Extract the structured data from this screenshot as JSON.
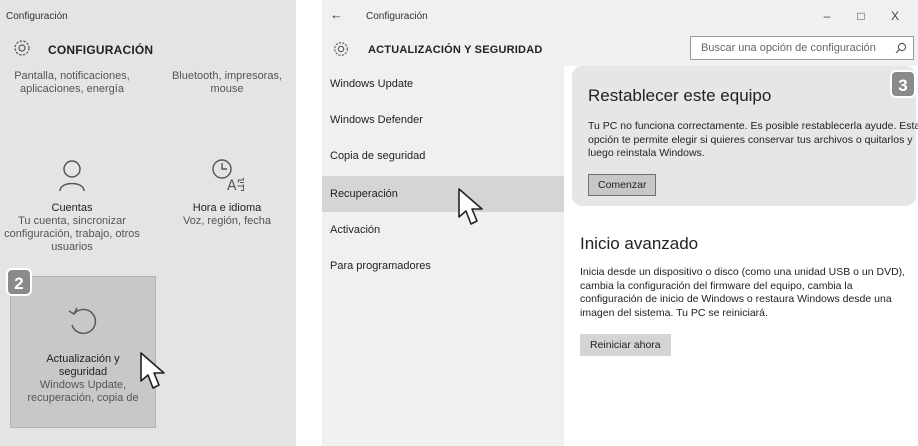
{
  "left": {
    "window_title": "Configuración",
    "header": "CONFIGURACIÓN",
    "tiles": {
      "pantalla": {
        "desc": "Pantalla, notificaciones, aplicaciones, energía"
      },
      "bluetooth": {
        "desc": "Bluetooth, impresoras, mouse"
      },
      "cuentas": {
        "title": "Cuentas",
        "desc": "Tu cuenta, sincronizar configuración, trabajo, otros usuarios",
        "icon": "person-icon"
      },
      "hora": {
        "title": "Hora e idioma",
        "desc": "Voz, región, fecha",
        "icon": "time-language-icon"
      },
      "actualizacion": {
        "title": "Actualización y seguridad",
        "desc": "Windows Update, recuperación, copia de",
        "icon": "update-icon"
      }
    },
    "badge": "2"
  },
  "right": {
    "window_title": "Configuración",
    "window_controls": {
      "minimize": "–",
      "maximize": "□",
      "close": "X"
    },
    "header": "ACTUALIZACIÓN Y SEGURIDAD",
    "search": {
      "placeholder": "Buscar una opción de configuración"
    },
    "nav": [
      {
        "label": "Windows Update"
      },
      {
        "label": "Windows Defender"
      },
      {
        "label": "Copia de seguridad"
      },
      {
        "label": "Recuperación",
        "active": true
      },
      {
        "label": "Activación"
      },
      {
        "label": "Para programadores"
      }
    ],
    "reset": {
      "title": "Restablecer este equipo",
      "desc": "Tu PC no funciona correctamente. Es posible restablecerla ayude. Esta opción te permite elegir si quieres conservar tus archivos o quitarlos y luego reinstala Windows.",
      "button": "Comenzar"
    },
    "advanced": {
      "title": "Inicio avanzado",
      "desc": "Inicia desde un dispositivo o disco (como una unidad USB o un DVD), cambia la configuración del firmware del equipo, cambia la configuración de inicio de Windows o restaura Windows desde una imagen del sistema. Tu PC se reiniciará.",
      "button": "Reiniciar ahora"
    },
    "badge": "3"
  },
  "colors": {
    "badge": "#8a8a8a",
    "selected_nav": "#d5d5d5",
    "highlight_box": "#e6e6e6"
  }
}
